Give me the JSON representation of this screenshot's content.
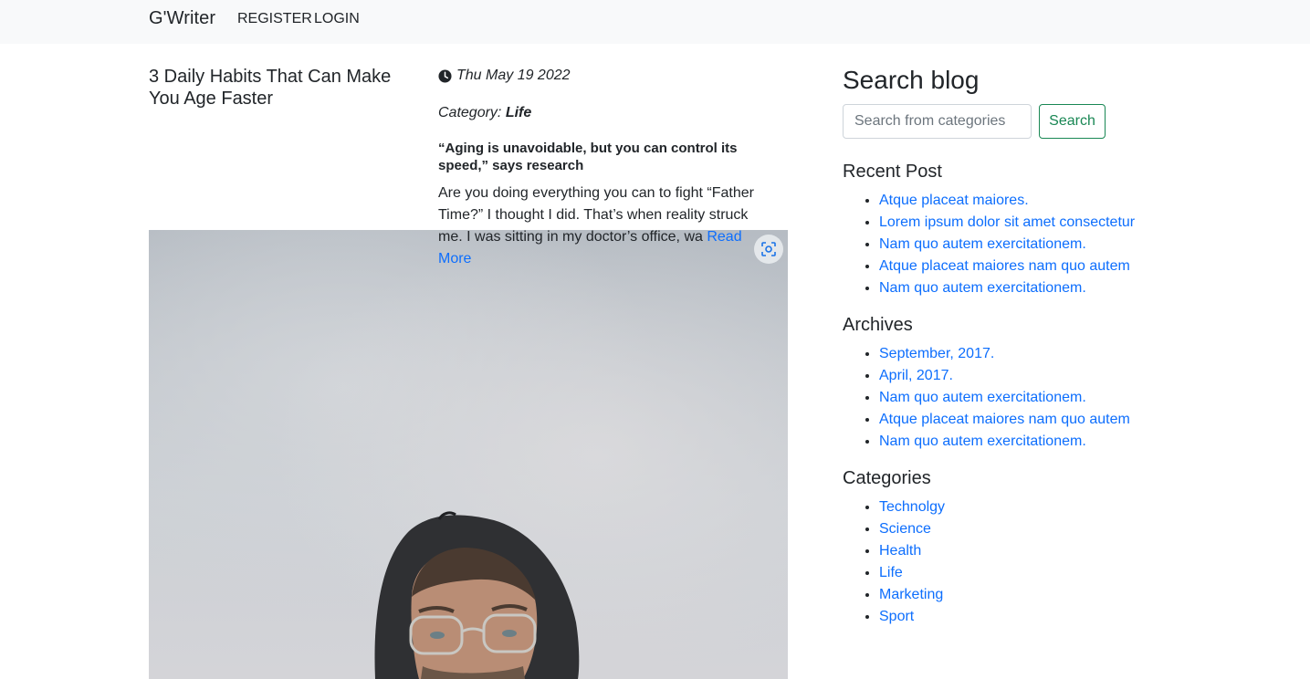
{
  "navbar": {
    "brand": "G'Writer",
    "register": "REGISTER",
    "login": "LOGIN"
  },
  "post": {
    "title": "3 Daily Habits That Can Make You Age Faster",
    "date": "Thu May 19 2022",
    "category_label": "Category:",
    "category_value": "Life",
    "subtitle": "“Aging is unavoidable, but you can control its speed,” says research",
    "excerpt": "Are you doing everything you can to fight “Father Time?” I thought I did. That’s when reality struck me. I was sitting in my doctor’s office, wa",
    "read_more": "Read More",
    "image_icon": "visual-search-icon"
  },
  "sidebar": {
    "search_heading": "Search blog",
    "search_placeholder": "Search from categories",
    "search_button": "Search",
    "recent_title": "Recent Post",
    "recent": [
      "Atque placeat maiores.",
      "Lorem ipsum dolor sit amet consectetur",
      "Nam quo autem exercitationem.",
      "Atque placeat maiores nam quo autem",
      "Nam quo autem exercitationem."
    ],
    "archives_title": "Archives",
    "archives": [
      "September, 2017.",
      "April, 2017.",
      "Nam quo autem exercitationem.",
      "Atque placeat maiores nam quo autem",
      "Nam quo autem exercitationem."
    ],
    "categories_title": "Categories",
    "categories": [
      "Technolgy",
      "Science",
      "Health",
      "Life",
      "Marketing",
      "Sport"
    ]
  },
  "colors": {
    "link": "#0d6efd",
    "success": "#198754",
    "navbar_bg": "#f8f9fa"
  }
}
